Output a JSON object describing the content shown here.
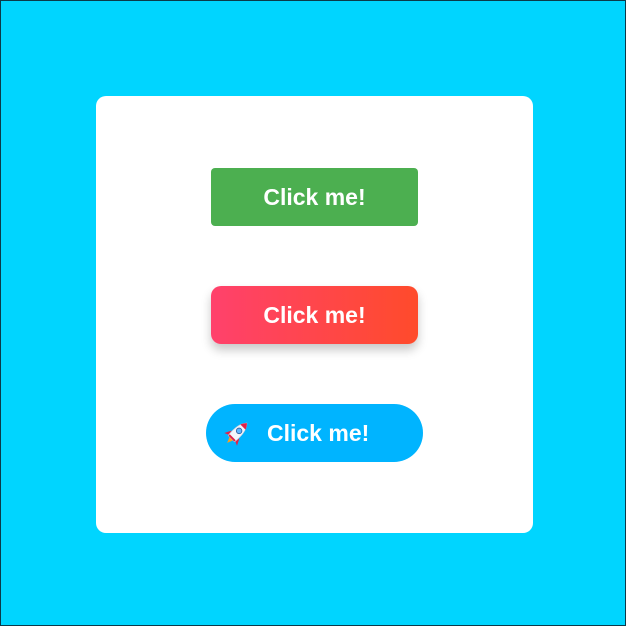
{
  "colors": {
    "page_background": "#00d5ff",
    "card_background": "#ffffff",
    "green_button": "#4caf50",
    "gradient_start": "#ff416c",
    "gradient_end": "#ff4b2b",
    "rocket_button": "#00b4ff",
    "button_text": "#ffffff"
  },
  "buttons": [
    {
      "label": "Click me!",
      "style": "solid-green"
    },
    {
      "label": "Click me!",
      "style": "gradient-shadow"
    },
    {
      "label": "Click me!",
      "style": "pill-with-icon",
      "icon": "rocket-icon"
    }
  ]
}
